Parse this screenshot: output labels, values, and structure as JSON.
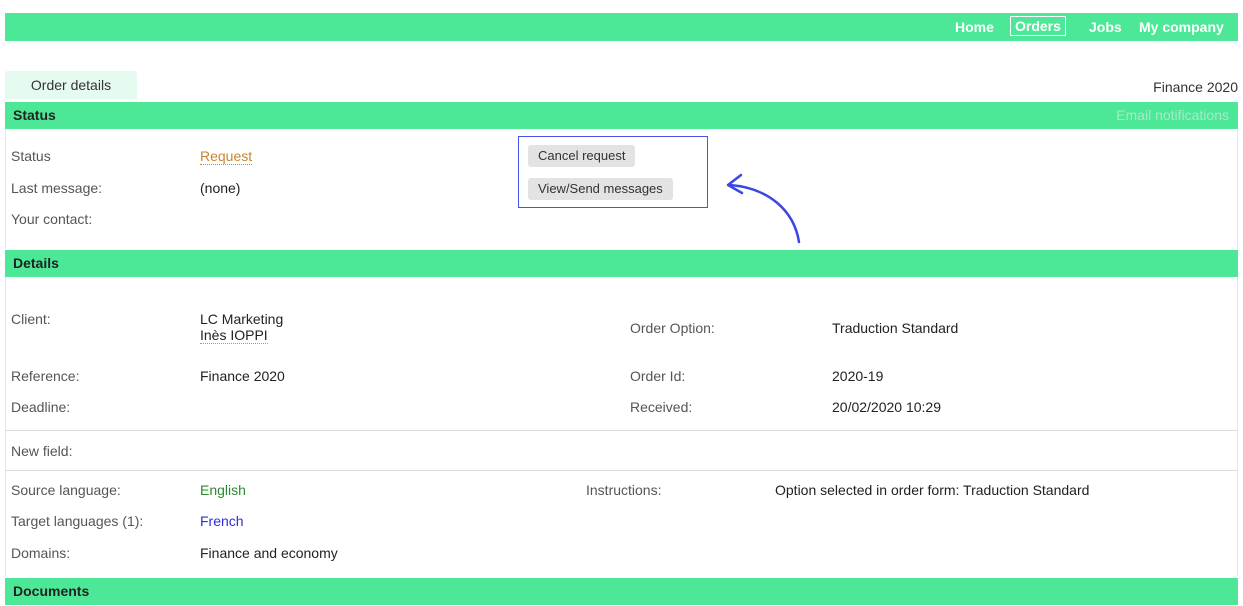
{
  "nav": {
    "items": [
      "Home",
      "Orders",
      "Jobs",
      "My company"
    ],
    "active": "Orders"
  },
  "tab": {
    "label": "Order details",
    "right_title": "Finance 2020"
  },
  "status_section": {
    "title": "Status",
    "email_link": "Email notifications",
    "rows": [
      {
        "label": "Status",
        "value": "Request"
      },
      {
        "label": "Last message:",
        "value": "(none)"
      },
      {
        "label": "Your contact:",
        "value": ""
      }
    ],
    "buttons": {
      "cancel": "Cancel request",
      "messages": "View/Send messages"
    }
  },
  "details_section": {
    "title": "Details",
    "client_label": "Client:",
    "client_name": "LC Marketing",
    "client_contact": "Inès IOPPI",
    "reference_label": "Reference:",
    "reference_value": "Finance 2020",
    "deadline_label": "Deadline:",
    "order_option_label": "Order Option:",
    "order_option_value": "Traduction Standard",
    "order_id_label": "Order Id:",
    "order_id_value": "2020-19",
    "received_label": "Received:",
    "received_value": "20/02/2020 10:29",
    "new_field_label": "New field:",
    "source_language_label": "Source language:",
    "source_language_value": "English",
    "target_languages_label": "Target languages (1):",
    "target_languages_value": "French",
    "domains_label": "Domains:",
    "domains_value": "Finance and economy",
    "instructions_label": "Instructions:",
    "instructions_value": "Option selected in order form: Traduction Standard"
  },
  "documents_section": {
    "title": "Documents"
  },
  "colors": {
    "accent": "#4de897",
    "highlight": "#4752e6",
    "status": "#c9852e",
    "source_lang": "#2b8a2b",
    "target_lang": "#2c2ce0"
  }
}
